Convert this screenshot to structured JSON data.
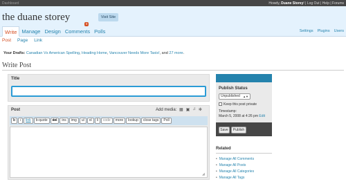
{
  "topbar": {
    "dashboard": "Dashboard",
    "howdy": "Howdy, ",
    "user": "Duane Storey",
    "links": "! | Log Out | Help | Forums"
  },
  "header": {
    "site_title": "the duane storey",
    "visit_site": "Visit Site"
  },
  "menu": {
    "items": [
      {
        "label": "Write"
      },
      {
        "label": "Manage"
      },
      {
        "label": "Design"
      },
      {
        "label": "Comments"
      },
      {
        "label": "Polls"
      }
    ],
    "comments_count": "0",
    "right_items": [
      "Settings",
      "Plugins",
      "Users"
    ]
  },
  "submenu": {
    "items": [
      "Post",
      "Page",
      "Link"
    ]
  },
  "drafts": {
    "label": "Your Drafts:",
    "items": [
      "Canadian Vs American Spelling",
      "Heading Home",
      "Vancouver Needs More Taxis!"
    ],
    "and": ", and ",
    "more": "27 more"
  },
  "page": {
    "title": "Write Post"
  },
  "title_box": {
    "label": "Title",
    "value": ""
  },
  "post_box": {
    "label": "Post",
    "add_media": "Add media:",
    "media_icons": [
      "▦",
      "▣",
      "♫",
      "✻"
    ],
    "toolbar": [
      "b",
      "i",
      "link",
      "b-quote",
      "del",
      "ins",
      "img",
      "ul",
      "ol",
      "li",
      "code",
      "more",
      "lookup",
      "close tags",
      "Poll"
    ]
  },
  "publish": {
    "heading": "Publish Status",
    "status": "Unpublished",
    "private_label": "Keep this post private",
    "timestamp_label": "Timestamp:",
    "timestamp_value": "March 5, 2008 at 4:26 pm",
    "edit": "Edit",
    "save": "Save",
    "publish": "Publish"
  },
  "related": {
    "heading": "Related",
    "items": [
      "Manage All Comments",
      "Manage All Posts",
      "Manage All Categories",
      "Manage All Tags"
    ]
  }
}
